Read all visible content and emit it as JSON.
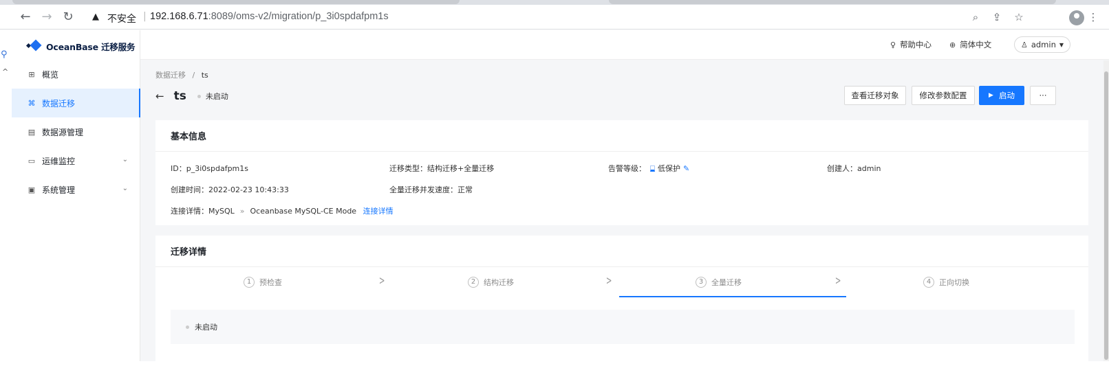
{
  "browser": {
    "insecure_label": "不安全",
    "url_host": "192.168.6.71",
    "url_rest": ":8089/oms-v2/migration/p_3i0spdafpm1s"
  },
  "app": {
    "product_name": "OceanBase 迁移服务",
    "sidebar": {
      "items": [
        {
          "label": "概览",
          "icon": "grid-icon"
        },
        {
          "label": "数据迁移",
          "icon": "migration-icon",
          "active": true
        },
        {
          "label": "数据源管理",
          "icon": "datasource-icon"
        },
        {
          "label": "运维监控",
          "icon": "monitor-icon",
          "expandable": true
        },
        {
          "label": "系统管理",
          "icon": "settings-icon",
          "expandable": true
        }
      ]
    },
    "topbar": {
      "help": "帮助中心",
      "language": "简体中文",
      "user": "admin"
    }
  },
  "page": {
    "breadcrumb": {
      "parent": "数据迁移",
      "separator": "/",
      "current": "ts"
    },
    "title": "ts",
    "status": "未启动",
    "actions": {
      "view_objects": "查看迁移对象",
      "modify_params": "修改参数配置",
      "start": "启动",
      "more": "···"
    },
    "basic_info": {
      "heading": "基本信息",
      "id_label": "ID：",
      "id_value": "p_3i0spdafpm1s",
      "type_label": "迁移类型：",
      "type_value": "结构迁移+全量迁移",
      "alarm_label": "告警等级：",
      "alarm_value": "低保护",
      "creator_label": "创建人：",
      "creator_value": "admin",
      "created_label": "创建时间：",
      "created_value": "2022-02-23 10:43:33",
      "speed_label": "全量迁移并发速度：",
      "speed_value": "正常",
      "conn_label": "连接详情：",
      "conn_source": "MySQL",
      "conn_arrow": "»",
      "conn_target": "Oceanbase MySQL-CE Mode",
      "conn_link": "连接详情"
    },
    "migration_detail": {
      "heading": "迁移详情",
      "steps": [
        {
          "num": "1",
          "label": "预检查"
        },
        {
          "num": "2",
          "label": "结构迁移"
        },
        {
          "num": "3",
          "label": "全量迁移",
          "selected": true
        },
        {
          "num": "4",
          "label": "正向切换"
        }
      ],
      "step_status": "未启动"
    }
  },
  "colors": {
    "accent": "#1677ff",
    "active_bg": "#e6f1fe",
    "page_bg": "#f5f6f8"
  }
}
